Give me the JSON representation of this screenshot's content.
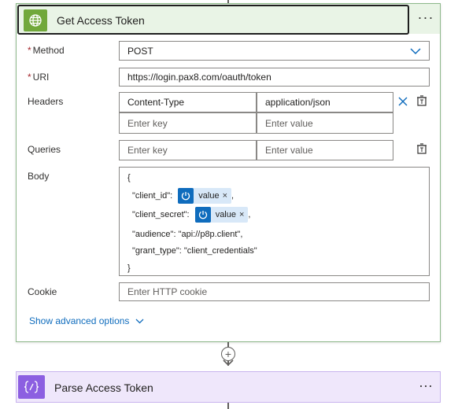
{
  "action": {
    "title": "Get Access Token",
    "more_label": "···",
    "fields": {
      "method": {
        "label": "Method",
        "required_mark": "*",
        "value": "POST"
      },
      "uri": {
        "label": "URI",
        "required_mark": "*",
        "value": "https://login.pax8.com/oauth/token"
      },
      "headers": {
        "label": "Headers",
        "rows": [
          {
            "key": "Content-Type",
            "value": "application/json"
          }
        ],
        "key_placeholder": "Enter key",
        "value_placeholder": "Enter value"
      },
      "queries": {
        "label": "Queries",
        "key_placeholder": "Enter key",
        "value_placeholder": "Enter value"
      },
      "body": {
        "label": "Body",
        "open_brace": "{",
        "close_brace": "}",
        "client_id_key": "\"client_id\":",
        "client_secret_key": "\"client_secret\":",
        "token_label": "value",
        "token_close": "×",
        "comma": ",",
        "audience_line": "\"audience\": \"api://p8p.client\",",
        "grant_type_line": "\"grant_type\": \"client_credentials\""
      },
      "cookie": {
        "label": "Cookie",
        "placeholder": "Enter HTTP cookie"
      }
    },
    "advanced_options_label": "Show advanced options"
  },
  "connector": {
    "add_symbol": "+"
  },
  "next_action": {
    "title": "Parse Access Token",
    "more_label": "···",
    "icon_symbol": "{∕}"
  },
  "colors": {
    "http_green": "#71a83b",
    "header_bg": "#e9f4e6",
    "parse_purple": "#8c5fe1",
    "parse_bg": "#efe7fb",
    "link_blue": "#0f6cbd",
    "token_bg": "#d8e8f8"
  }
}
